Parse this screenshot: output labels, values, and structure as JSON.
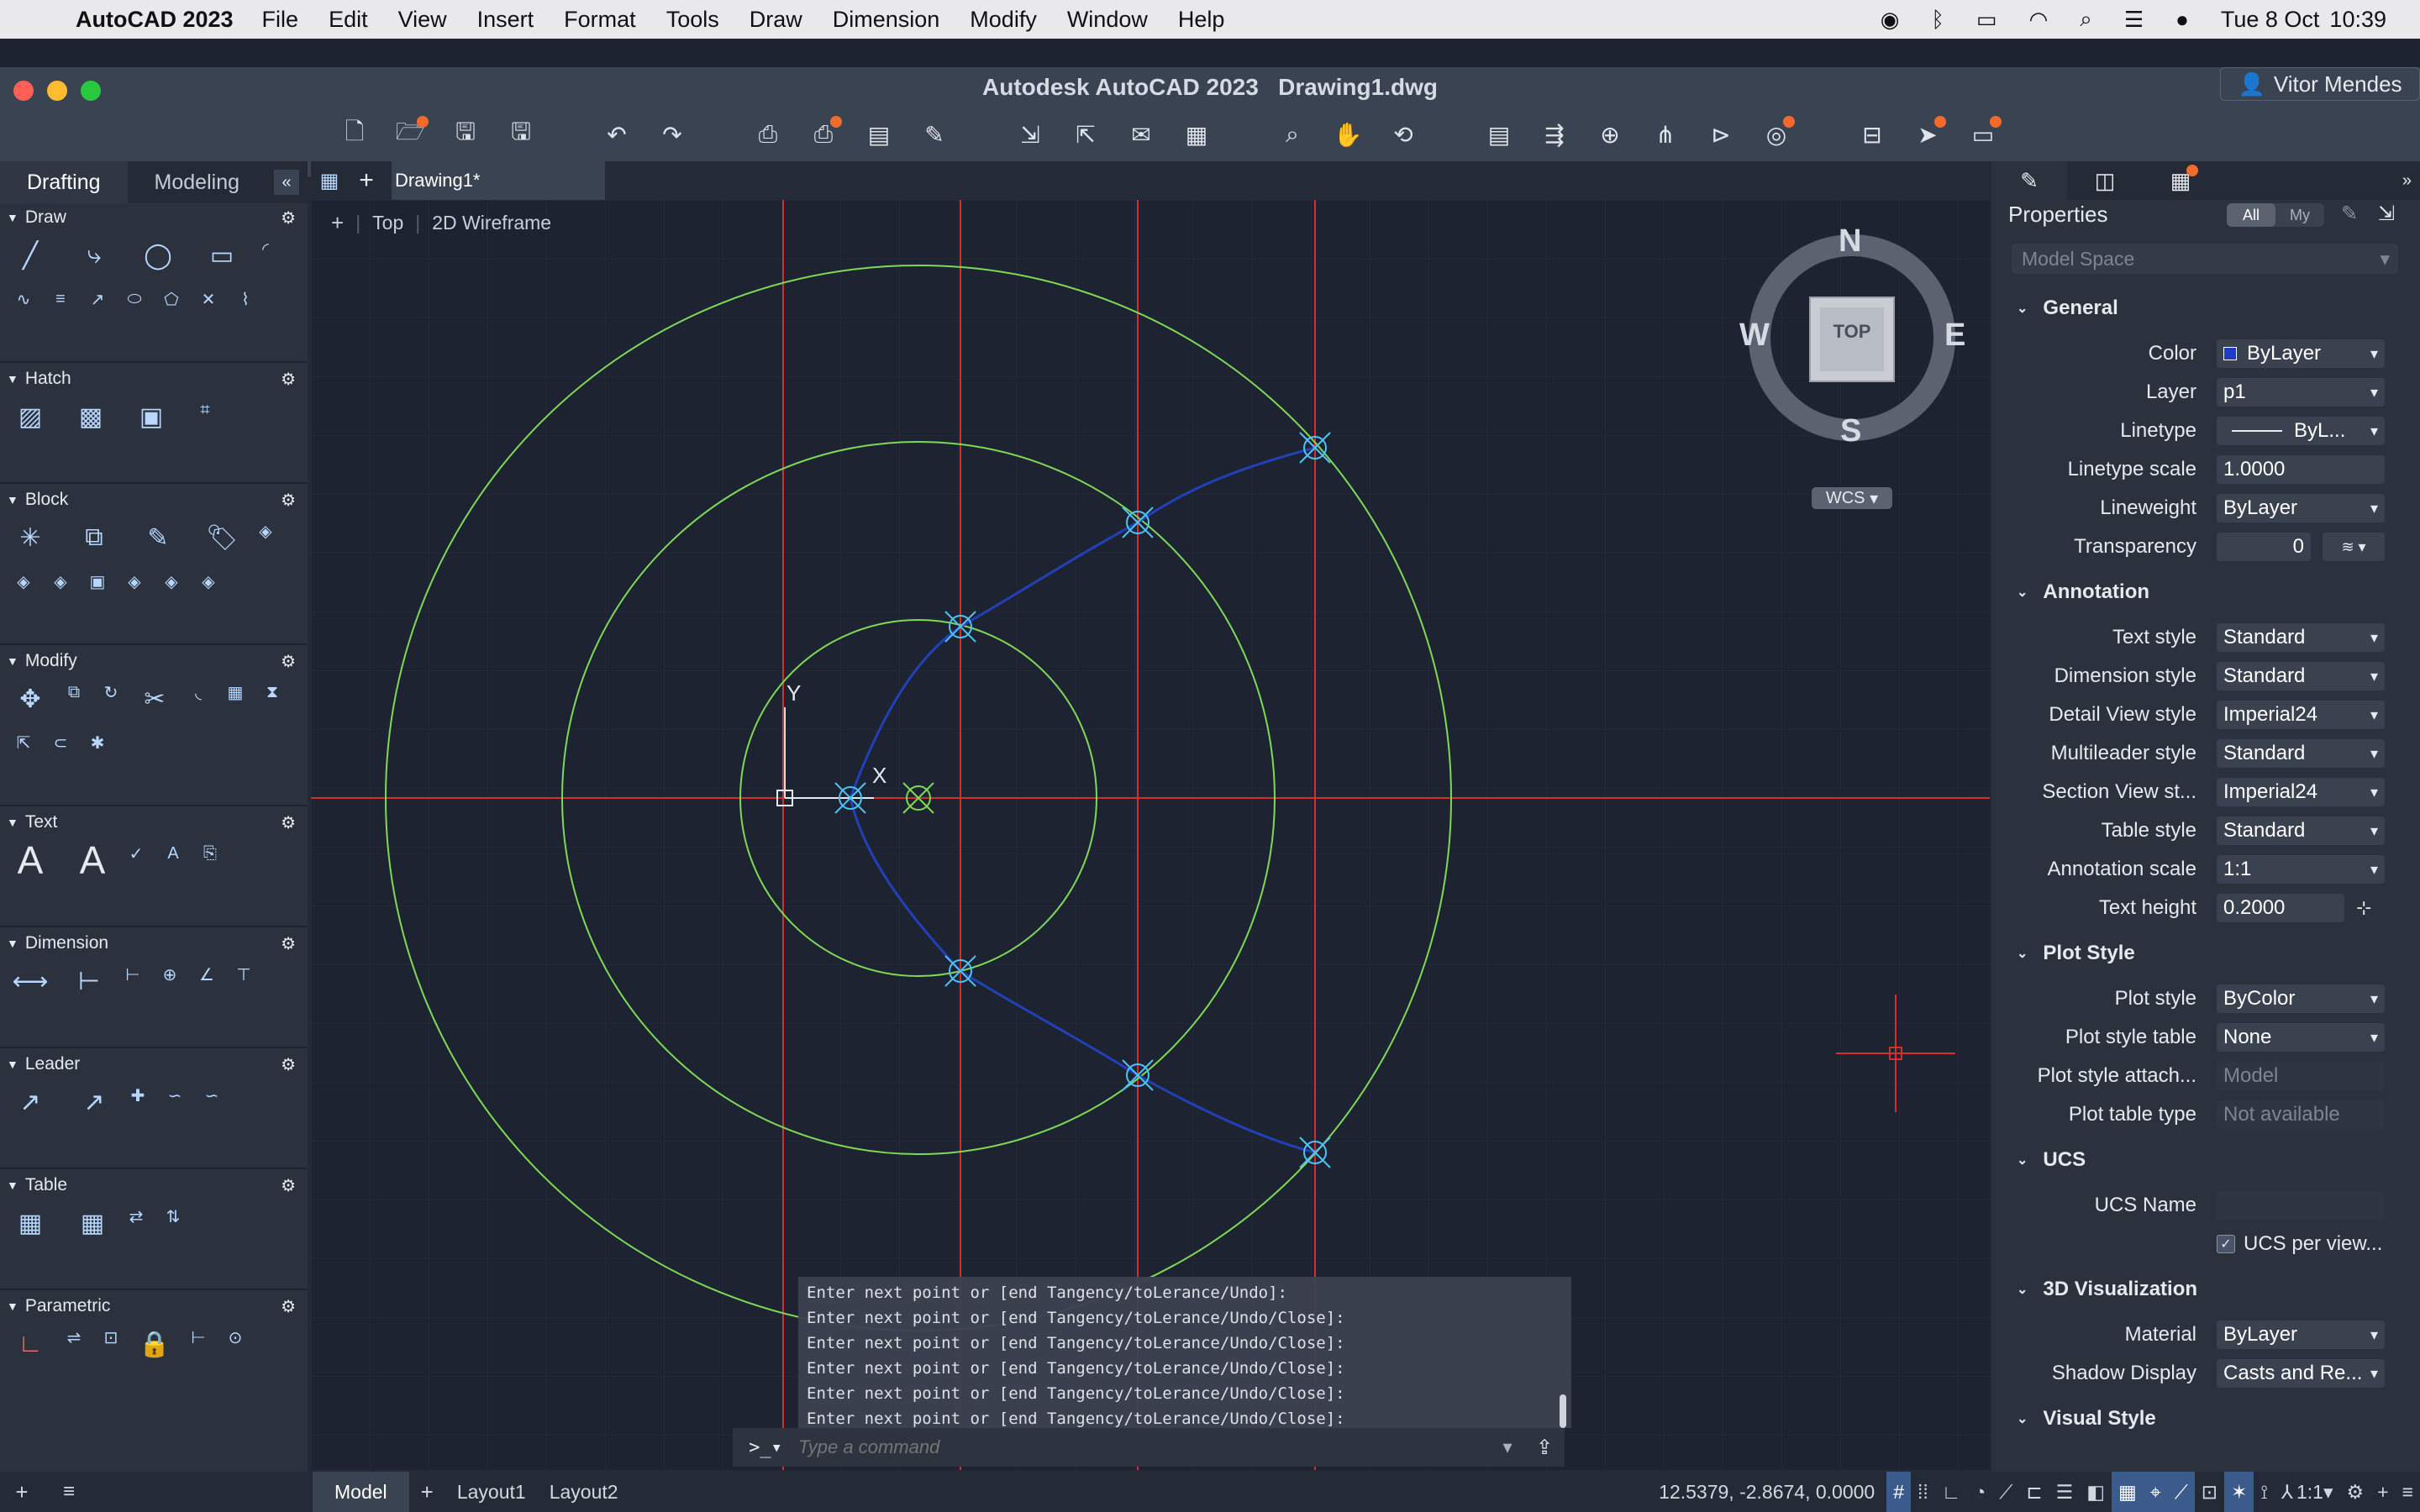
{
  "menubar": {
    "app_name": "AutoCAD 2023",
    "items": [
      "File",
      "Edit",
      "View",
      "Insert",
      "Format",
      "Tools",
      "Draw",
      "Dimension",
      "Modify",
      "Window",
      "Help"
    ],
    "date": "Tue 8 Oct",
    "time": "10:39"
  },
  "window": {
    "title": "Autodesk AutoCAD 2023",
    "file": "Drawing1.dwg",
    "user": "Vitor Mendes"
  },
  "left_panel": {
    "tabs": [
      "Drafting",
      "Modeling"
    ],
    "sections": [
      "Draw",
      "Hatch",
      "Block",
      "Modify",
      "Text",
      "Dimension",
      "Leader",
      "Table",
      "Parametric"
    ]
  },
  "doc_tab": {
    "label": "Drawing1*"
  },
  "viewport": {
    "view": "Top",
    "style": "2D Wireframe"
  },
  "viewcube": {
    "n": "N",
    "s": "S",
    "e": "E",
    "w": "W",
    "center": "TOP",
    "wcs": "WCS"
  },
  "command": {
    "history": [
      "Enter next point or [end Tangency/toLerance/Undo]:",
      "Enter next point or [end Tangency/toLerance/Undo/Close]:",
      "Enter next point or [end Tangency/toLerance/Undo/Close]:",
      "Enter next point or [end Tangency/toLerance/Undo/Close]:",
      "Enter next point or [end Tangency/toLerance/Undo/Close]:",
      "Enter next point or [end Tangency/toLerance/Undo/Close]:"
    ],
    "placeholder": "Type a command",
    "prompt": ">_"
  },
  "properties": {
    "title": "Properties",
    "filter_all": "All",
    "filter_my": "My",
    "space": "Model Space",
    "general": {
      "header": "General",
      "color_label": "Color",
      "color": "ByLayer",
      "layer_label": "Layer",
      "layer": "p1",
      "linetype_label": "Linetype",
      "linetype": "ByL...",
      "ltscale_label": "Linetype scale",
      "ltscale": "1.0000",
      "lineweight_label": "Lineweight",
      "lineweight": "ByLayer",
      "transparency_label": "Transparency",
      "transparency": "0"
    },
    "annotation": {
      "header": "Annotation",
      "text_style_label": "Text style",
      "text_style": "Standard",
      "dim_style_label": "Dimension style",
      "dim_style": "Standard",
      "detail_label": "Detail View style",
      "detail": "Imperial24",
      "mleader_label": "Multileader style",
      "mleader": "Standard",
      "section_label": "Section View st...",
      "section": "Imperial24",
      "table_label": "Table style",
      "table": "Standard",
      "ann_scale_label": "Annotation scale",
      "ann_scale": "1:1",
      "text_height_label": "Text height",
      "text_height": "0.2000"
    },
    "plot": {
      "header": "Plot Style",
      "style_label": "Plot style",
      "style": "ByColor",
      "table_label": "Plot style table",
      "table": "None",
      "attach_label": "Plot style attach...",
      "attach": "Model",
      "type_label": "Plot table type",
      "type": "Not available"
    },
    "ucs": {
      "header": "UCS",
      "name_label": "UCS Name",
      "per_view": "UCS per view..."
    },
    "viz3d": {
      "header": "3D Visualization",
      "material_label": "Material",
      "material": "ByLayer",
      "shadow_label": "Shadow Display",
      "shadow": "Casts and Re..."
    },
    "visual_style": {
      "header": "Visual Style"
    }
  },
  "status": {
    "model": "Model",
    "layout1": "Layout1",
    "layout2": "Layout2",
    "coords": "12.5379, -2.8674, 0.0000",
    "scale": "1:1"
  },
  "colors": {
    "accent": "#f26b2d",
    "circle": "#7ed957",
    "spline": "#2240b8",
    "axis": "#d32f2f",
    "marker": "#4fc3f7"
  }
}
